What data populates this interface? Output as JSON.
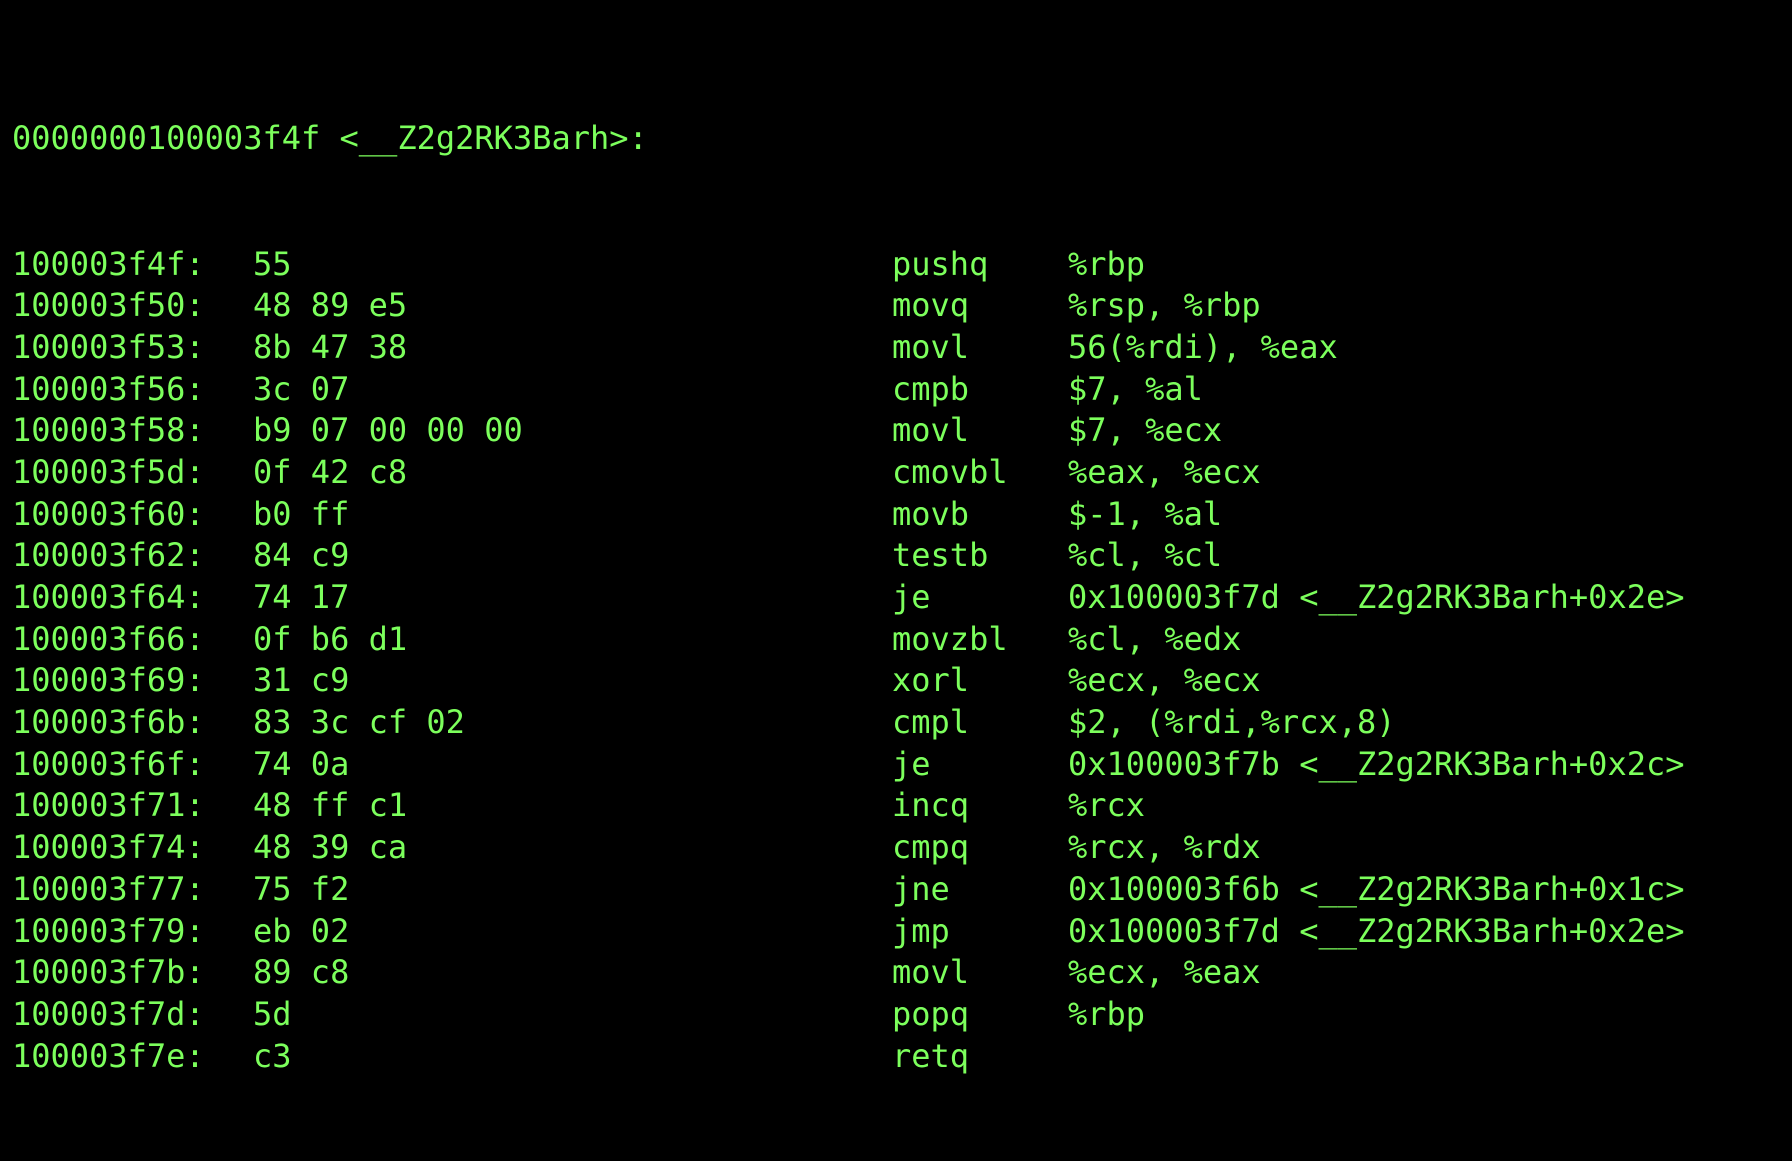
{
  "terminal": {
    "background": "#000000",
    "text_color": "#7CFF5C",
    "header": "0000000100003f4f <__Z2g2RK3Barh>:",
    "lines": [
      {
        "addr": "100003f4f:",
        "bytes": "55",
        "mnemonic": "pushq",
        "operands": "%rbp"
      },
      {
        "addr": "100003f50:",
        "bytes": "48 89 e5",
        "mnemonic": "movq",
        "operands": "%rsp, %rbp"
      },
      {
        "addr": "100003f53:",
        "bytes": "8b 47 38",
        "mnemonic": "movl",
        "operands": "56(%rdi), %eax"
      },
      {
        "addr": "100003f56:",
        "bytes": "3c 07",
        "mnemonic": "cmpb",
        "operands": "$7, %al"
      },
      {
        "addr": "100003f58:",
        "bytes": "b9 07 00 00 00",
        "mnemonic": "movl",
        "operands": "$7, %ecx"
      },
      {
        "addr": "100003f5d:",
        "bytes": "0f 42 c8",
        "mnemonic": "cmovbl",
        "operands": "%eax, %ecx"
      },
      {
        "addr": "100003f60:",
        "bytes": "b0 ff",
        "mnemonic": "movb",
        "operands": "$-1, %al"
      },
      {
        "addr": "100003f62:",
        "bytes": "84 c9",
        "mnemonic": "testb",
        "operands": "%cl, %cl"
      },
      {
        "addr": "100003f64:",
        "bytes": "74 17",
        "mnemonic": "je",
        "operands": "0x100003f7d <__Z2g2RK3Barh+0x2e>"
      },
      {
        "addr": "100003f66:",
        "bytes": "0f b6 d1",
        "mnemonic": "movzbl",
        "operands": "%cl, %edx"
      },
      {
        "addr": "100003f69:",
        "bytes": "31 c9",
        "mnemonic": "xorl",
        "operands": "%ecx, %ecx"
      },
      {
        "addr": "100003f6b:",
        "bytes": "83 3c cf 02",
        "mnemonic": "cmpl",
        "operands": "$2, (%rdi,%rcx,8)"
      },
      {
        "addr": "100003f6f:",
        "bytes": "74 0a",
        "mnemonic": "je",
        "operands": "0x100003f7b <__Z2g2RK3Barh+0x2c>"
      },
      {
        "addr": "100003f71:",
        "bytes": "48 ff c1",
        "mnemonic": "incq",
        "operands": "%rcx"
      },
      {
        "addr": "100003f74:",
        "bytes": "48 39 ca",
        "mnemonic": "cmpq",
        "operands": "%rcx, %rdx"
      },
      {
        "addr": "100003f77:",
        "bytes": "75 f2",
        "mnemonic": "jne",
        "operands": "0x100003f6b <__Z2g2RK3Barh+0x1c>"
      },
      {
        "addr": "100003f79:",
        "bytes": "eb 02",
        "mnemonic": "jmp",
        "operands": "0x100003f7d <__Z2g2RK3Barh+0x2e>"
      },
      {
        "addr": "100003f7b:",
        "bytes": "89 c8",
        "mnemonic": "movl",
        "operands": "%ecx, %eax"
      },
      {
        "addr": "100003f7d:",
        "bytes": "5d",
        "mnemonic": "popq",
        "operands": "%rbp"
      },
      {
        "addr": "100003f7e:",
        "bytes": "c3",
        "mnemonic": "retq",
        "operands": ""
      }
    ]
  }
}
